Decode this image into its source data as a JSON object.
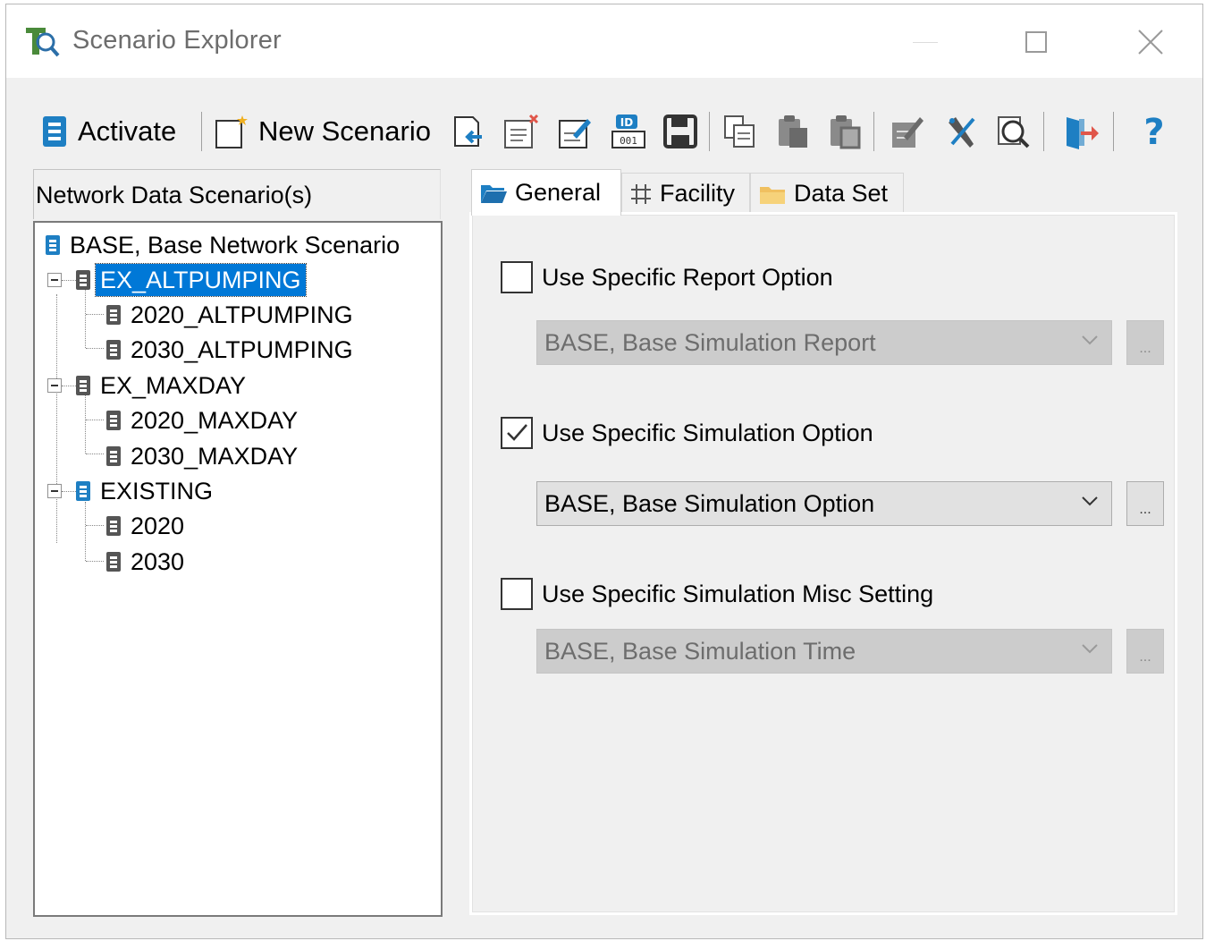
{
  "window": {
    "title": "Scenario Explorer"
  },
  "toolbar": {
    "activate_label": "Activate",
    "new_scenario_label": "New Scenario",
    "icons": [
      "import-icon",
      "delete-scenario-icon",
      "edit-scenario-icon",
      "id-icon",
      "save-icon",
      "copy-icon",
      "paste-icon",
      "paste-special-icon",
      "edit-query-icon",
      "tools-icon",
      "inspect-icon",
      "exit-icon",
      "help-icon"
    ]
  },
  "tree": {
    "header": "Network Data Scenario(s)",
    "nodes": [
      {
        "label": "BASE, Base Network Scenario"
      },
      {
        "label": "EX_ALTPUMPING",
        "selected": true
      },
      {
        "label": "2020_ALTPUMPING"
      },
      {
        "label": "2030_ALTPUMPING"
      },
      {
        "label": "EX_MAXDAY"
      },
      {
        "label": "2020_MAXDAY"
      },
      {
        "label": "2030_MAXDAY"
      },
      {
        "label": "EXISTING"
      },
      {
        "label": "2020"
      },
      {
        "label": "2030"
      }
    ]
  },
  "tabs": [
    {
      "label": "General",
      "active": true
    },
    {
      "label": "Facility"
    },
    {
      "label": "Data Set"
    }
  ],
  "general": {
    "report": {
      "label": "Use Specific Report Option",
      "checked": false,
      "value": "BASE, Base Simulation Report"
    },
    "simulation": {
      "label": "Use Specific Simulation Option",
      "checked": true,
      "value": "BASE, Base Simulation Option"
    },
    "misc": {
      "label": "Use Specific Simulation Misc Setting",
      "checked": false,
      "value": "BASE, Base Simulation Time"
    },
    "ellipsis": "..."
  },
  "colors": {
    "selection": "#0078d7",
    "accent_blue": "#1e7fc3",
    "exit_red": "#e0564a"
  }
}
